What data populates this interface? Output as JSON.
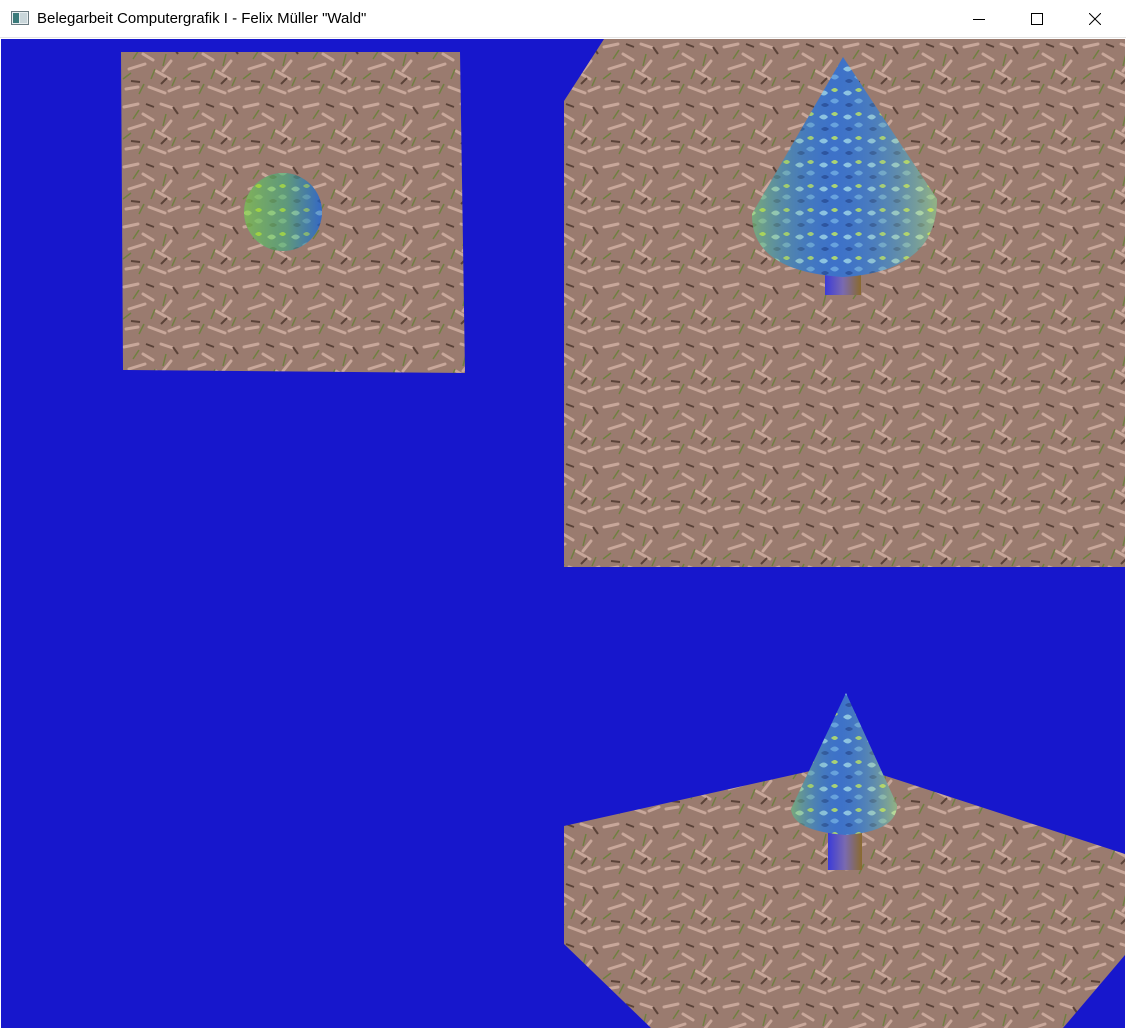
{
  "window": {
    "title": "Belegarbeit Computergrafik I - Felix Müller \"Wald\"",
    "app_icon": "opengl-window-icon",
    "controls": {
      "minimize_icon": "minimize-icon",
      "maximize_icon": "maximize-icon",
      "close_icon": "close-icon"
    }
  },
  "scene": {
    "background_color": "#1717cc",
    "ground_color": "#9b7a6e",
    "grass_color": "#6f7a3a",
    "foliage_colors": [
      "#2f6fd0",
      "#8fcf3a",
      "#2a4e8f"
    ],
    "trunk_colors": [
      "#3b3bd8",
      "#8a6a2e"
    ],
    "views": [
      {
        "name": "top-view",
        "object": "sphere-tree-top"
      },
      {
        "name": "perspective-view",
        "object": "cone-tree"
      },
      {
        "name": "side-view",
        "object": "cone-tree"
      },
      {
        "name": "empty-view",
        "object": "none"
      }
    ]
  }
}
